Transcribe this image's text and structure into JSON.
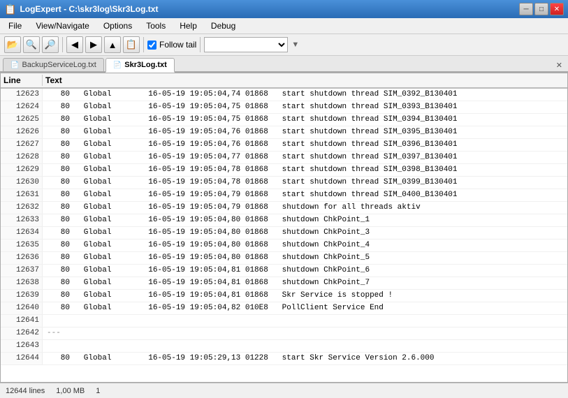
{
  "titleBar": {
    "title": "LogExpert - C:\\skr3log\\Skr3Log.txt",
    "controls": [
      "─",
      "□",
      "✕"
    ]
  },
  "menuBar": {
    "items": [
      "File",
      "View/Navigate",
      "Options",
      "Tools",
      "Help",
      "Debug"
    ]
  },
  "toolbar": {
    "buttons": [
      "📂",
      "🔍",
      "🔎",
      "⬅",
      "➡",
      "⬆",
      "📋"
    ],
    "followTail": {
      "checked": true,
      "label": "Follow tail"
    },
    "dropdown": {
      "value": "",
      "placeholder": ""
    }
  },
  "tabs": [
    {
      "id": "tab1",
      "label": "BackupServiceLog.txt",
      "active": false
    },
    {
      "id": "tab2",
      "label": "Skr3Log.txt",
      "active": true
    }
  ],
  "logHeader": {
    "lineCol": "Line",
    "textCol": "Text"
  },
  "logRows": [
    {
      "line": "12623",
      "text": "   80   Global        16-05-19 19:05:04,74 01868   start shutdown thread SIM_0392_B130401"
    },
    {
      "line": "12624",
      "text": "   80   Global        16-05-19 19:05:04,75 01868   start shutdown thread SIM_0393_B130401"
    },
    {
      "line": "12625",
      "text": "   80   Global        16-05-19 19:05:04,75 01868   start shutdown thread SIM_0394_B130401"
    },
    {
      "line": "12626",
      "text": "   80   Global        16-05-19 19:05:04,76 01868   start shutdown thread SIM_0395_B130401"
    },
    {
      "line": "12627",
      "text": "   80   Global        16-05-19 19:05:04,76 01868   start shutdown thread SIM_0396_B130401"
    },
    {
      "line": "12628",
      "text": "   80   Global        16-05-19 19:05:04,77 01868   start shutdown thread SIM_0397_B130401"
    },
    {
      "line": "12629",
      "text": "   80   Global        16-05-19 19:05:04,78 01868   start shutdown thread SIM_0398_B130401"
    },
    {
      "line": "12630",
      "text": "   80   Global        16-05-19 19:05:04,78 01868   start shutdown thread SIM_0399_B130401"
    },
    {
      "line": "12631",
      "text": "   80   Global        16-05-19 19:05:04,79 01868   start shutdown thread SIM_0400_B130401"
    },
    {
      "line": "12632",
      "text": "   80   Global        16-05-19 19:05:04,79 01868   shutdown for all threads aktiv"
    },
    {
      "line": "12633",
      "text": "   80   Global        16-05-19 19:05:04,80 01868   shutdown ChkPoint_1"
    },
    {
      "line": "12634",
      "text": "   80   Global        16-05-19 19:05:04,80 01868   shutdown ChkPoint_3"
    },
    {
      "line": "12635",
      "text": "   80   Global        16-05-19 19:05:04,80 01868   shutdown ChkPoint_4"
    },
    {
      "line": "12636",
      "text": "   80   Global        16-05-19 19:05:04,80 01868   shutdown ChkPoint_5"
    },
    {
      "line": "12637",
      "text": "   80   Global        16-05-19 19:05:04,81 01868   shutdown ChkPoint_6"
    },
    {
      "line": "12638",
      "text": "   80   Global        16-05-19 19:05:04,81 01868   shutdown ChkPoint_7"
    },
    {
      "line": "12639",
      "text": "   80   Global        16-05-19 19:05:04,81 01868   Skr Service is stopped !"
    },
    {
      "line": "12640",
      "text": "   80   Global        16-05-19 19:05:04,82 010E8   PollClient Service End"
    },
    {
      "line": "12641",
      "text": ""
    },
    {
      "line": "12642",
      "text": "---"
    },
    {
      "line": "12643",
      "text": ""
    },
    {
      "line": "12644",
      "text": "   80   Global        16-05-19 19:05:29,13 01228   start Skr Service Version 2.6.000"
    }
  ],
  "statusBar": {
    "lines": "12644 lines",
    "size": "1,00 MB",
    "col": "1"
  }
}
